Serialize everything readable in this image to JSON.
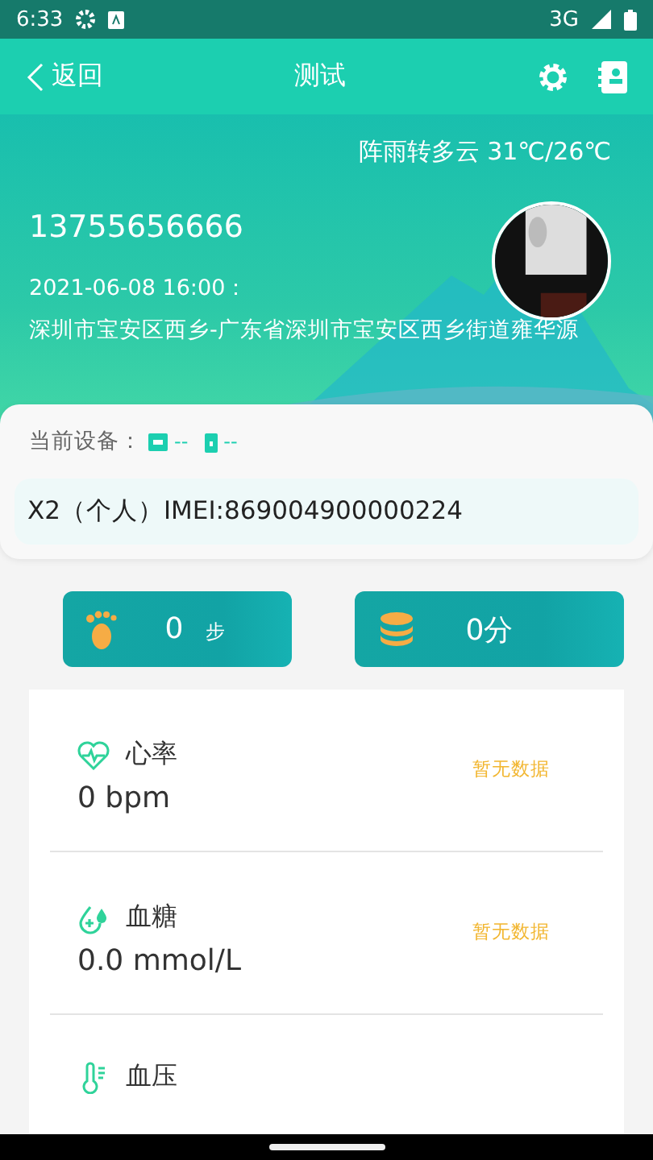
{
  "status_bar": {
    "time": "6:33",
    "network": "3G"
  },
  "header": {
    "back": "返回",
    "title": "测试"
  },
  "weather": "阵雨转多云 31℃/26℃",
  "user": {
    "phone": "13755656666",
    "location_time": "2021-06-08 16:00：",
    "address": "深圳市宝安区西乡-广东省深圳市宝安区西乡街道雍华源"
  },
  "device": {
    "label": "当前设备：",
    "signal": "--",
    "battery": "--",
    "name": "X2（个人）IMEI:869004900000224"
  },
  "stats": [
    {
      "kind": "steps",
      "value": "0",
      "unit": "步"
    },
    {
      "kind": "points",
      "value": "0分"
    }
  ],
  "metrics": [
    {
      "kind": "heart",
      "title": "心率",
      "value": "0 bpm",
      "status": "暂无数据"
    },
    {
      "kind": "sugar",
      "title": "血糖",
      "value": "0.0 mmol/L",
      "status": "暂无数据"
    },
    {
      "kind": "pressure",
      "title": "血压"
    }
  ]
}
